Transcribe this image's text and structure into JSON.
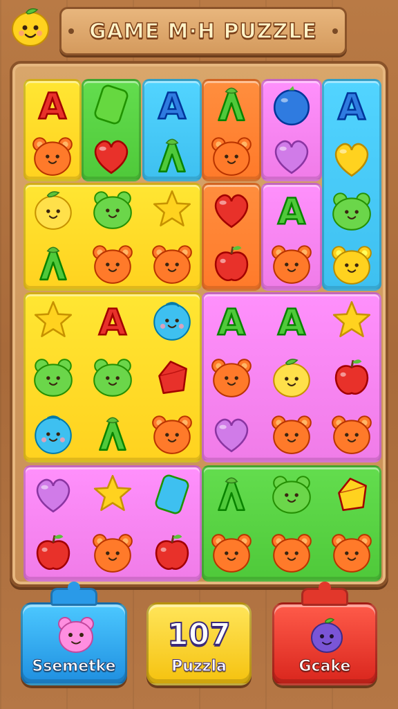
{
  "header": {
    "title": "GAME M·H PUZZLE",
    "logo_icon": "lemon-face-icon"
  },
  "colors": {
    "yellow": "#ffd21f",
    "green": "#4fc93a",
    "blue": "#3ec0f0",
    "orange": "#ff7a2a",
    "pink": "#f07ce8",
    "wood": "#b97a45"
  },
  "board": {
    "panels": [
      {
        "name": "panel-yellow-a",
        "color": "yellow",
        "tiles": [
          "letter-a-icon",
          "bear-face-icon"
        ]
      },
      {
        "name": "panel-green-a",
        "color": "green",
        "tiles": [
          "block-icon",
          "heart-icon"
        ]
      },
      {
        "name": "panel-blue-a",
        "color": "blue",
        "tiles": [
          "letter-a-icon",
          "leaf-a-icon"
        ]
      },
      {
        "name": "panel-orange-a",
        "color": "orange",
        "tiles": [
          "leaf-a-icon",
          "bear-face-icon"
        ]
      },
      {
        "name": "panel-pink-a",
        "color": "pink",
        "tiles": [
          "berry-icon",
          "heart-icon"
        ]
      },
      {
        "name": "panel-blue-tall",
        "color": "blue",
        "tiles": [
          "letter-a-icon",
          "heart-icon",
          "frog-face-icon",
          "bear-face-icon"
        ]
      },
      {
        "name": "panel-yellow-big",
        "color": "yellow",
        "tiles": [
          "lemon-face-icon",
          "frog-face-icon",
          "star-icon",
          "leaf-a-icon",
          "bear-face-icon",
          "bear-face-icon"
        ]
      },
      {
        "name": "panel-orange-b",
        "color": "orange",
        "tiles": [
          "heart-icon",
          "apple-icon"
        ]
      },
      {
        "name": "panel-pink-b",
        "color": "pink",
        "tiles": [
          "letter-a-icon",
          "bear-face-icon"
        ]
      },
      {
        "name": "panel-yellow-grid",
        "color": "yellow",
        "tiles": [
          "star-icon",
          "letter-a-icon",
          "blob-face-icon",
          "frog-face-icon",
          "frog-face-icon",
          "gem-icon",
          "blob-face-icon",
          "leaf-a-icon",
          "bear-face-icon"
        ]
      },
      {
        "name": "panel-pink-grid",
        "color": "pink",
        "tiles": [
          "letter-a-icon",
          "letter-a-icon",
          "star-icon",
          "bear-face-icon",
          "lemon-face-icon",
          "apple-icon",
          "heart-icon",
          "bear-face-icon",
          "bear-face-icon"
        ]
      },
      {
        "name": "panel-pink-bottom",
        "color": "pink",
        "tiles": [
          "heart-icon",
          "star-icon",
          "block-icon",
          "apple-icon",
          "bear-face-icon",
          "apple-icon"
        ]
      },
      {
        "name": "panel-green-bottom",
        "color": "green",
        "tiles": [
          "leaf-a-icon",
          "frog-face-icon",
          "gem-icon",
          "bear-face-icon",
          "bear-face-icon",
          "bear-face-icon"
        ]
      }
    ]
  },
  "bottom_bar": {
    "left_button": {
      "label": "Ssemetke",
      "icon": "pink-bear-icon"
    },
    "center_display": {
      "value": "107",
      "label": "Puzzla"
    },
    "right_button": {
      "label": "Gcake",
      "icon": "purple-berry-icon"
    }
  }
}
